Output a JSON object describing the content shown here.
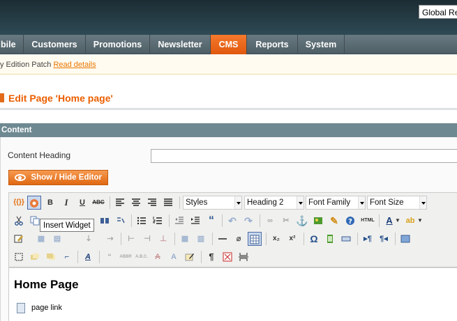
{
  "header": {
    "store_scope": "Global Re"
  },
  "nav": {
    "items": [
      "bile",
      "Customers",
      "Promotions",
      "Newsletter",
      "CMS",
      "Reports",
      "System"
    ],
    "active": "CMS"
  },
  "notice": {
    "text": "y Edition Patch",
    "link": "Read details"
  },
  "page": {
    "title": "Edit Page 'Home page'"
  },
  "section": {
    "title": "Content",
    "heading_label": "Content Heading",
    "heading_value": "",
    "toggle_button": "Show / Hide Editor"
  },
  "toolbar": {
    "styles": "Styles",
    "format": "Heading 2",
    "font_family": "Font Family",
    "font_size": "Font Size",
    "tooltip": "Insert Widget",
    "glyph_bold": "B",
    "glyph_italic": "I",
    "glyph_underline": "U",
    "glyph_strike": "ABC",
    "glyph_quote": "“",
    "glyph_html": "HTML",
    "glyph_abbr": "ABBR",
    "glyph_acronym": "A.B.C.",
    "glyph_omega": "Ω",
    "glyph_pilcrow": "¶",
    "glyph_sub": "x₂",
    "glyph_sup": "x²",
    "glyph_var": "{{}}"
  },
  "editor": {
    "heading": "Home Page",
    "link_text": "page link"
  },
  "colors": {
    "accent": "#eb5e00",
    "nav_active": "#e95f10",
    "section_header": "#6f8992"
  }
}
